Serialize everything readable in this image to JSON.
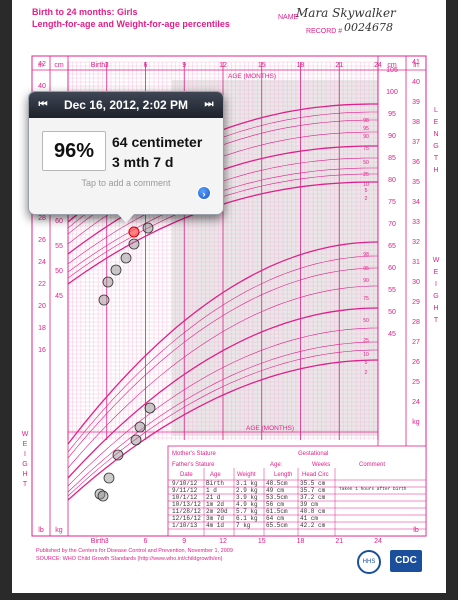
{
  "header": {
    "title_line1": "Birth to 24 months: Girls",
    "title_line2": "Length-for-age and Weight-for-age percentiles",
    "name_label": "NAME",
    "name_value": "Mara Skywalker",
    "record_label": "RECORD #",
    "record_value": "0024678"
  },
  "axis": {
    "top_months": [
      "Birth",
      "3",
      "6",
      "9",
      "12",
      "15",
      "18",
      "21",
      "24"
    ],
    "age_label": "AGE (MONTHS)",
    "bottom_months": [
      "Birth",
      "3",
      "6",
      "9",
      "12",
      "15",
      "18",
      "21",
      "24"
    ],
    "left_in": "in",
    "left_cm": "cm",
    "right_cm": "cm",
    "right_in": "in",
    "length_vertical": "LENGTH",
    "weight_vertical": "WEIGHT",
    "kg": "kg",
    "lb": "lb"
  },
  "percentile_labels": [
    "98",
    "95",
    "90",
    "75",
    "50",
    "25",
    "10",
    "5",
    "2"
  ],
  "popover": {
    "date": "Dec 16, 2012, 2:02 PM",
    "prev_icon": "skip-back-icon",
    "next_icon": "skip-forward-icon",
    "percentile": "96%",
    "measurement": "64 centimeter",
    "age": "3 mth 7 d",
    "comment_prompt": "Tap to add a comment",
    "disclosure_icon": "detail-disclosure-icon"
  },
  "table": {
    "mother_stature": "Mother's Stature",
    "father_stature": "Father's Stature",
    "gestational": "Gestational",
    "age_label": "Age:",
    "weeks": "Weeks",
    "comment": "Comment",
    "columns": [
      "Date",
      "Age",
      "Weight",
      "Length",
      "Head Circ"
    ],
    "rows": [
      [
        "9/10/12",
        "Birth",
        "3.1 kg",
        "48.5cm",
        "35.5 cm"
      ],
      [
        "9/11/12",
        "1 d",
        "2.9 kg",
        "49 cm",
        "35.7 cm"
      ],
      [
        "10/1/12",
        "21 d",
        "3.9 kg",
        "53.5cm",
        "37.2 cm"
      ],
      [
        "10/13/12",
        "1m 2d",
        "4.9 kg",
        "56 cm",
        "39 cm"
      ],
      [
        "11/28/12",
        "2m 20d",
        "5.7 kg",
        "61.5cm",
        "40.8 cm"
      ],
      [
        "12/16/12",
        "3m 7d",
        "6.1 kg",
        "64 cm",
        "41 cm"
      ],
      [
        "1/10/13",
        "4m 1d",
        "7 kg",
        "65.5cm",
        "42.2 cm"
      ]
    ],
    "first_comment": "Taken 1 hours after birth"
  },
  "footer": {
    "line1": "Published by the Centers for Disease Control and Prevention, November 1, 2009",
    "line2": "SOURCE: WHO Child Growth Standards (http://www.who.int/childgrowth/en)",
    "cdc": "CDC",
    "hhs": "HHS"
  },
  "colors": {
    "grid": "#e0208a",
    "grid_light": "#f4b8d6",
    "shade": "#d8d8d8",
    "popover_header": "#2a303c"
  }
}
